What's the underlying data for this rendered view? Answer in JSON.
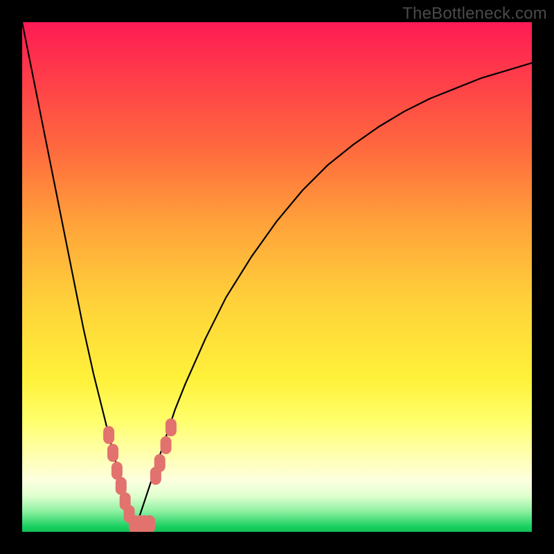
{
  "watermark": "TheBottleneck.com",
  "chart_data": {
    "type": "line",
    "title": "",
    "xlabel": "",
    "ylabel": "",
    "xlim": [
      0,
      100
    ],
    "ylim": [
      0,
      100
    ],
    "x_min_point": 22,
    "series": [
      {
        "name": "curve",
        "x": [
          0,
          2,
          4,
          6,
          8,
          10,
          12,
          14,
          16,
          18,
          20,
          22,
          24,
          26,
          28,
          30,
          32,
          36,
          40,
          45,
          50,
          55,
          60,
          65,
          70,
          75,
          80,
          85,
          90,
          95,
          100
        ],
        "y": [
          100,
          90,
          80,
          70,
          60,
          50,
          40,
          31,
          23,
          15,
          8,
          0,
          6,
          12,
          18,
          24,
          29,
          38,
          46,
          54,
          61,
          67,
          72,
          76,
          79.5,
          82.5,
          85,
          87,
          89,
          90.5,
          92
        ]
      }
    ],
    "markers": [
      {
        "name": "marker-left-1",
        "x": 17.0,
        "y": 19.0
      },
      {
        "name": "marker-left-2",
        "x": 17.8,
        "y": 15.5
      },
      {
        "name": "marker-left-3",
        "x": 18.6,
        "y": 12.0
      },
      {
        "name": "marker-left-4",
        "x": 19.4,
        "y": 9.0
      },
      {
        "name": "marker-left-5",
        "x": 20.2,
        "y": 6.0
      },
      {
        "name": "marker-left-6",
        "x": 21.0,
        "y": 3.5
      },
      {
        "name": "marker-bottom-1",
        "x": 22.0,
        "y": 1.5
      },
      {
        "name": "marker-bottom-2",
        "x": 23.0,
        "y": 1.5
      },
      {
        "name": "marker-bottom-3",
        "x": 24.0,
        "y": 1.5
      },
      {
        "name": "marker-bottom-4",
        "x": 25.0,
        "y": 1.5
      },
      {
        "name": "marker-right-1",
        "x": 26.2,
        "y": 11.0
      },
      {
        "name": "marker-right-2",
        "x": 27.0,
        "y": 13.5
      },
      {
        "name": "marker-right-3",
        "x": 28.2,
        "y": 17.0
      },
      {
        "name": "marker-right-4",
        "x": 29.2,
        "y": 20.5
      }
    ],
    "colors": {
      "curve": "#000000",
      "markers": "#e2726e",
      "background_top": "#ff1a54",
      "background_bottom": "#0fbf56"
    }
  }
}
